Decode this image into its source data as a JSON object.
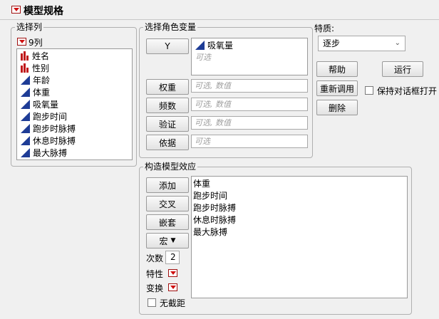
{
  "header": {
    "title": "模型规格"
  },
  "select_columns": {
    "legend": "选择列",
    "count_label": "9列",
    "columns": [
      {
        "name": "姓名",
        "type": "nominal"
      },
      {
        "name": "性别",
        "type": "nominal"
      },
      {
        "name": "年龄",
        "type": "continuous"
      },
      {
        "name": "体重",
        "type": "continuous"
      },
      {
        "name": "吸氧量",
        "type": "continuous"
      },
      {
        "name": "跑步时间",
        "type": "continuous"
      },
      {
        "name": "跑步时脉搏",
        "type": "continuous"
      },
      {
        "name": "休息时脉搏",
        "type": "continuous"
      },
      {
        "name": "最大脉搏",
        "type": "continuous"
      }
    ]
  },
  "roles": {
    "legend": "选择角色变量",
    "y": {
      "button": "Y",
      "value": "吸氧量",
      "hint": "可选"
    },
    "weight": {
      "button": "权重",
      "placeholder": "可选, 数值"
    },
    "freq": {
      "button": "频数",
      "placeholder": "可选, 数值"
    },
    "validation": {
      "button": "验证",
      "placeholder": "可选, 数值"
    },
    "by": {
      "button": "依据",
      "placeholder": "可选"
    }
  },
  "personality": {
    "label": "特质:",
    "value": "逐步"
  },
  "actions": {
    "help": "帮助",
    "run": "运行",
    "recall": "重新调用",
    "keep_open": "保持对话框打开",
    "remove": "删除"
  },
  "effects": {
    "legend": "构造模型效应",
    "add": "添加",
    "cross": "交叉",
    "nest": "嵌套",
    "macros": "宏",
    "degree_label": "次数",
    "degree_value": "2",
    "attributes_label": "特性",
    "transform_label": "变换",
    "no_intercept": "无截距",
    "items": [
      "体重",
      "跑步时间",
      "跑步时脉搏",
      "休息时脉搏",
      "最大脉搏"
    ]
  },
  "colors": {
    "accent_red": "#d01010",
    "continuous_icon": "#1e3c96",
    "nominal_icon": "#c0181a"
  }
}
